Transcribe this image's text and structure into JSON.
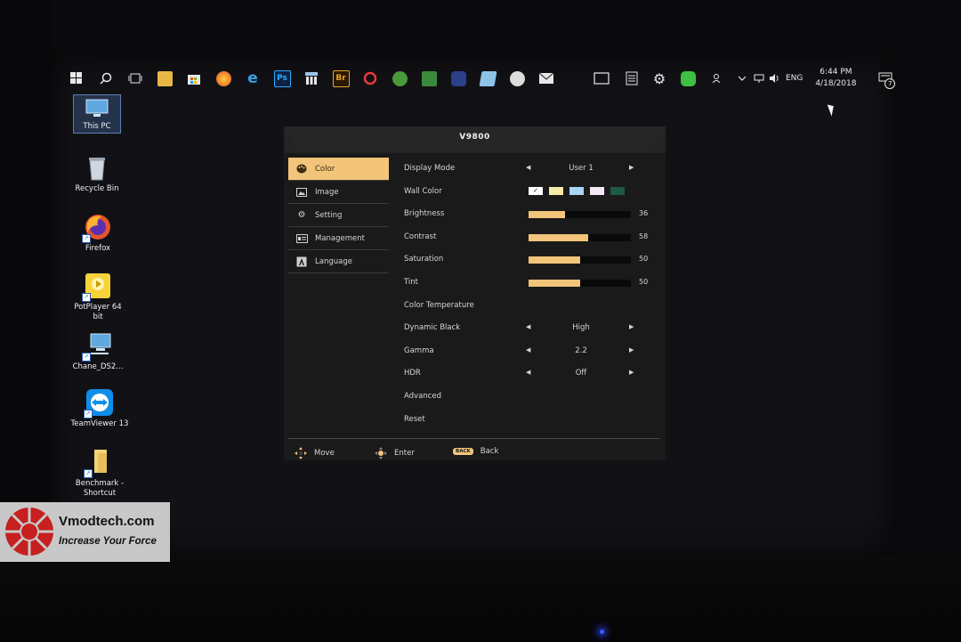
{
  "taskbar": {
    "left_icons": [
      {
        "icon": "windows-start-icon"
      },
      {
        "icon": "search-icon"
      },
      {
        "icon": "task-view-icon"
      },
      {
        "icon": "file-explorer-icon"
      },
      {
        "icon": "store-icon"
      },
      {
        "icon": "firefox-icon"
      },
      {
        "icon": "edge-icon"
      },
      {
        "icon": "photoshop-icon",
        "text": "Ps"
      },
      {
        "icon": "app-grid-icon"
      },
      {
        "icon": "bridge-icon",
        "text": "Br"
      },
      {
        "icon": "nero-icon"
      },
      {
        "icon": "xbox-icon"
      },
      {
        "icon": "gpu-tool-icon"
      },
      {
        "icon": "robot-app-icon"
      },
      {
        "icon": "paper-app-icon"
      },
      {
        "icon": "paint-icon"
      },
      {
        "icon": "mail-icon"
      }
    ],
    "right_icons": [
      {
        "icon": "window-icon"
      },
      {
        "icon": "calculator-icon"
      },
      {
        "icon": "gear-icon"
      },
      {
        "icon": "line-chat-icon"
      }
    ],
    "tray": {
      "people_icon": "people-icon",
      "lang": "ENG",
      "time": "6:44 PM",
      "date": "4/18/2018",
      "notification_count": "7"
    }
  },
  "desktop_icons": [
    {
      "label": "This PC"
    },
    {
      "label": "Recycle Bin"
    },
    {
      "label": "Firefox"
    },
    {
      "label": "PotPlayer 64 bit"
    },
    {
      "label": "Chane_DS2..."
    },
    {
      "label": "TeamViewer 13"
    },
    {
      "label": "Benchmark - Shortcut"
    }
  ],
  "osd": {
    "title": "V9800",
    "categories": [
      {
        "label": "Color",
        "icon": "palette-icon",
        "active": true
      },
      {
        "label": "Image",
        "icon": "image-icon",
        "active": false
      },
      {
        "label": "Setting",
        "icon": "gear-icon",
        "active": false
      },
      {
        "label": "Management",
        "icon": "management-icon",
        "active": false
      },
      {
        "label": "Language",
        "icon": "language-icon",
        "active": false
      }
    ],
    "settings": {
      "display_mode": {
        "label": "Display Mode",
        "value": "User 1"
      },
      "wall_color": {
        "label": "Wall Color",
        "swatches": [
          "#ffffff",
          "#f5eaa8",
          "#a8d6f5",
          "#f3e6f5",
          "#1f5a44"
        ],
        "selected_index": 0
      },
      "brightness": {
        "label": "Brightness",
        "value": "36"
      },
      "contrast": {
        "label": "Contrast",
        "value": "58"
      },
      "saturation": {
        "label": "Saturation",
        "value": "50"
      },
      "tint": {
        "label": "Tint",
        "value": "50"
      },
      "color_temperature": {
        "label": "Color Temperature"
      },
      "dynamic_black": {
        "label": "Dynamic Black",
        "value": "High"
      },
      "gamma": {
        "label": "Gamma",
        "value": "2.2"
      },
      "hdr": {
        "label": "HDR",
        "value": "Off"
      },
      "advanced": {
        "label": "Advanced"
      },
      "reset": {
        "label": "Reset"
      }
    },
    "footer": {
      "move": "Move",
      "enter": "Enter",
      "back_pill": "BACK",
      "back": "Back"
    },
    "accent": "#f2c57a"
  },
  "watermark": {
    "title": "Vmodtech.com",
    "tagline": "Increase Your Force"
  }
}
